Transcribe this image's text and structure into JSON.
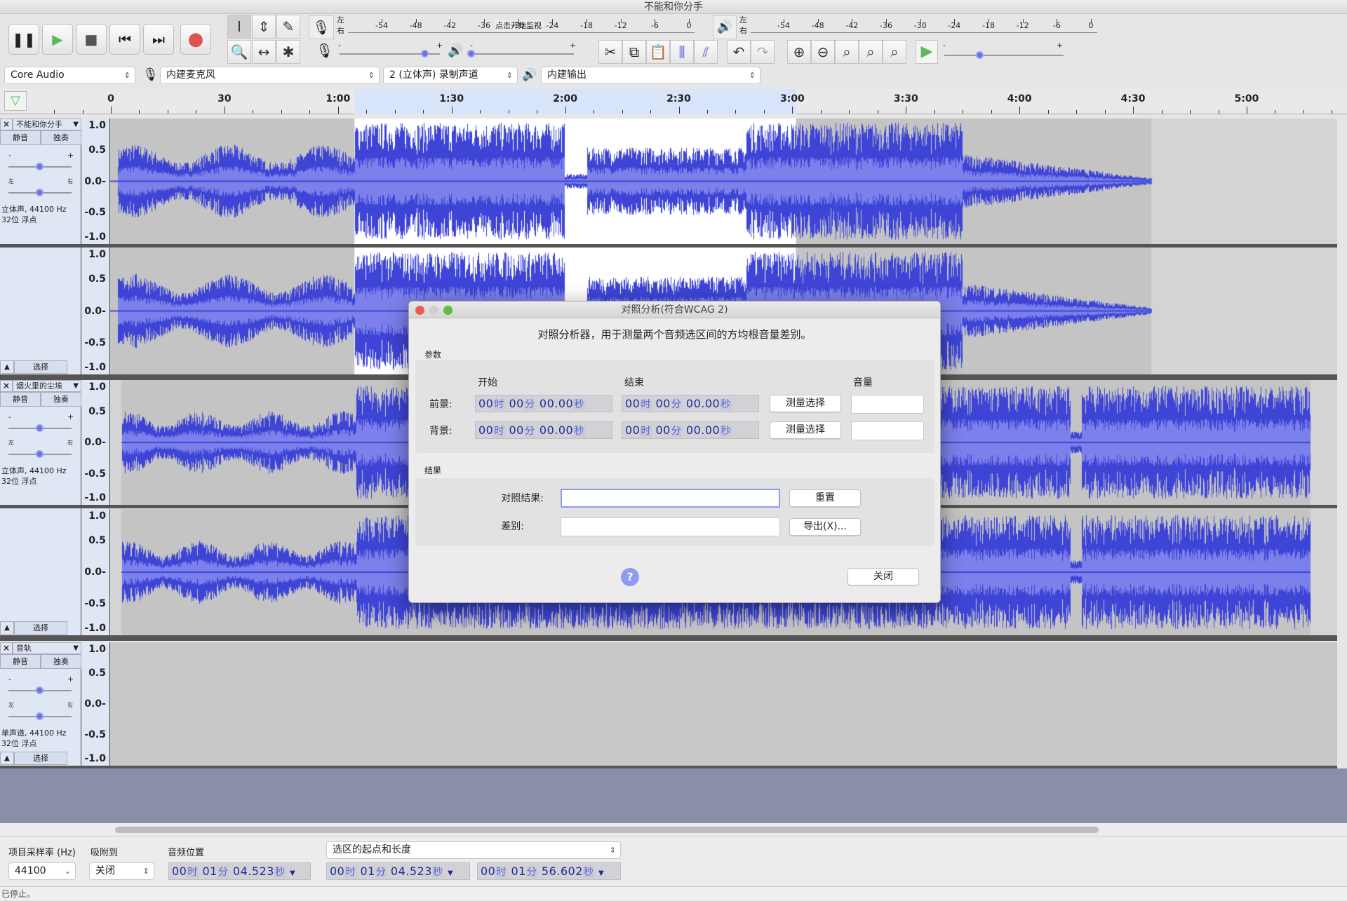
{
  "window": {
    "title": "不能和你分手"
  },
  "toolbar": {
    "transport": [
      {
        "name": "pause",
        "glyph": "❚❚"
      },
      {
        "name": "play",
        "glyph": "▶"
      },
      {
        "name": "stop",
        "glyph": "■"
      },
      {
        "name": "skip-start",
        "glyph": "⏮"
      },
      {
        "name": "skip-end",
        "glyph": "⏭"
      },
      {
        "name": "record",
        "glyph": "●"
      }
    ],
    "tools": [
      "I",
      "⇕",
      "✎",
      "🔍",
      "↔",
      "✱"
    ],
    "rec_meter": {
      "left": "左",
      "right": "右",
      "ticks": [
        "-54",
        "-48",
        "-42",
        "-36",
        "-30",
        "-24",
        "-18",
        "-12",
        "-6",
        "0"
      ],
      "hint": "点击开始监视"
    },
    "play_meter": {
      "left": "左",
      "right": "右",
      "ticks": [
        "-54",
        "-48",
        "-42",
        "-36",
        "-30",
        "-24",
        "-18",
        "-12",
        "-6",
        "0"
      ]
    },
    "rec_slider": {
      "minus": "-",
      "plus": "+",
      "value": 0.85
    },
    "play_slider": {
      "minus": "-",
      "plus": "+",
      "value": 0.0
    },
    "speed_slider": {
      "minus": "-",
      "plus": "+",
      "value": 0.3
    },
    "edit": [
      "✂",
      "⧉",
      "📋",
      "⫼",
      "⫽"
    ],
    "undo": "↶",
    "redo": "↷",
    "zoom": [
      "⊕",
      "⊖",
      "⌕",
      "⌕",
      "⌕"
    ]
  },
  "devices": {
    "host": "Core Audio",
    "input": "内建麦克风",
    "channels": "2 (立体声) 录制声道",
    "output": "内建输出"
  },
  "ruler": {
    "labels": [
      "0",
      "30",
      "1:00",
      "1:30",
      "2:00",
      "2:30",
      "3:00",
      "3:30",
      "4:00",
      "4:30",
      "5:00"
    ]
  },
  "colors": {
    "wave": "#3d44d6",
    "rms": "#7b80ea",
    "clip_bg": "#c4c4c4",
    "selected_bg": "#ffffff",
    "empty_bg": "#d6d6d6",
    "panel": "#dfe7f4"
  },
  "tracks": [
    {
      "name": "不能和你分手",
      "mute": "静音",
      "solo": "独奏",
      "gain_minus": "-",
      "gain_plus": "+",
      "pan_left": "左",
      "pan_right": "右",
      "info1": "立体声, 44100 Hz",
      "info2": "32位 浮点",
      "select": "选择",
      "scale": [
        "1.0",
        "0.5",
        "0.0-",
        "-0.5",
        "-1.0"
      ]
    },
    {
      "name": "烟火里的尘埃",
      "mute": "静音",
      "solo": "独奏",
      "gain_minus": "-",
      "gain_plus": "+",
      "pan_left": "左",
      "pan_right": "右",
      "info1": "立体声, 44100 Hz",
      "info2": "32位 浮点",
      "select": "选择",
      "scale": [
        "1.0",
        "0.5",
        "0.0-",
        "-0.5",
        "-1.0"
      ]
    },
    {
      "name": "音轨",
      "mute": "静音",
      "solo": "独奏",
      "gain_minus": "-",
      "gain_plus": "+",
      "pan_left": "左",
      "pan_right": "右",
      "info1": "单声道, 44100 Hz",
      "info2": "32位 浮点",
      "select": "选择",
      "scale": [
        "1.0",
        "0.5",
        "0.0-",
        "-0.5",
        "-1.0"
      ]
    }
  ],
  "dialog": {
    "title": "对照分析(符合WCAG 2)",
    "description": "对照分析器，用于测量两个音频选区间的方均根音量差别。",
    "params_label": "参数",
    "col_start": "开始",
    "col_end": "结束",
    "col_volume": "音量",
    "rows": [
      {
        "label": "前景:",
        "start": [
          "00",
          "时",
          "00",
          "分",
          "00.00",
          "秒"
        ],
        "end": [
          "00",
          "时",
          "00",
          "分",
          "00.00",
          "秒"
        ],
        "button": "测量选择",
        "volume": ""
      },
      {
        "label": "背景:",
        "start": [
          "00",
          "时",
          "00",
          "分",
          "00.00",
          "秒"
        ],
        "end": [
          "00",
          "时",
          "00",
          "分",
          "00.00",
          "秒"
        ],
        "button": "测量选择",
        "volume": ""
      }
    ],
    "results_label": "结果",
    "contrast_label": "对照结果:",
    "contrast_value": "",
    "diff_label": "差别:",
    "diff_value": "",
    "reset": "重置",
    "export": "导出(X)...",
    "help": "?",
    "close": "关闭"
  },
  "selection_bar": {
    "rate_label": "项目采样率 (Hz)",
    "rate_value": "44100",
    "snap_label": "吸附到",
    "snap_value": "关闭",
    "pos_label": "音频位置",
    "mode": "选区的起点和长度",
    "pos": [
      "00",
      "时",
      "01",
      "分",
      "04.523",
      "秒"
    ],
    "sel_start": [
      "00",
      "时",
      "01",
      "分",
      "04.523",
      "秒"
    ],
    "sel_length": [
      "00",
      "时",
      "01",
      "分",
      "56.602",
      "秒"
    ]
  },
  "status": "已停止。"
}
